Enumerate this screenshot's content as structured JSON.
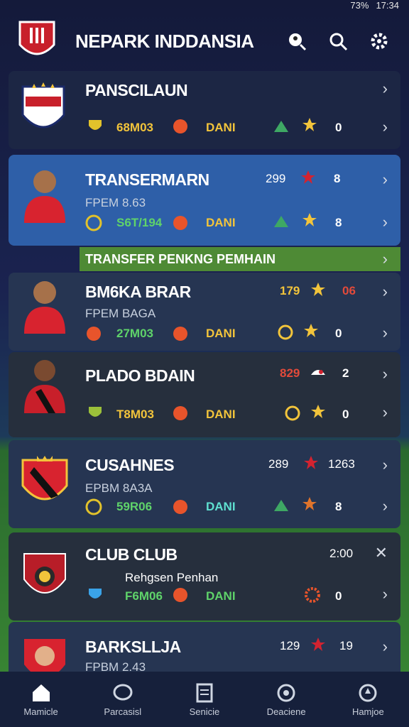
{
  "status": {
    "battery": "73%",
    "time": "17:34"
  },
  "header": {
    "title": "NEPARK INDDANSIA"
  },
  "cards": [
    {
      "name": "PANSCILAUN",
      "stat1": "68M03",
      "stat2": "DANI",
      "right": "0"
    },
    {
      "name": "TRANSERMARN",
      "sub": "FPEM 8.63",
      "stat1": "S6T/194",
      "stat2": "DANI",
      "num": "299",
      "right1": "8",
      "right2": "8"
    },
    {
      "name": "BM6KA BRAR",
      "sub": "FPEM BAGA",
      "stat1": "27M03",
      "stat2": "DANI",
      "num": "179",
      "right1": "06",
      "right2": "0"
    },
    {
      "name": "PLADO BDAIN",
      "stat1": "T8M03",
      "stat2": "DANI",
      "num": "829",
      "right1": "2",
      "right2": "0"
    },
    {
      "name": "CUSAHNES",
      "sub": "EPBM 8A3A",
      "stat1": "59R06",
      "stat2": "DANI",
      "num": "289",
      "right1": "1263",
      "right2": "8"
    },
    {
      "name": "CLUB CLUB",
      "sub": "Rehgsen Penhan",
      "stat1": "F6M06",
      "stat2": "DANI",
      "num": "2:00",
      "right2": "0"
    },
    {
      "name": "BARKSLLJA",
      "sub": "FPBM 2.43",
      "num": "129",
      "right1": "19"
    }
  ],
  "banner": {
    "label": "TRANSFER PENKNG PEMHAIN"
  },
  "nav": [
    {
      "label": "Mamicle"
    },
    {
      "label": "Parcasisl"
    },
    {
      "label": "Senicie"
    },
    {
      "label": "Deaciene"
    },
    {
      "label": "Hamjoe"
    }
  ]
}
